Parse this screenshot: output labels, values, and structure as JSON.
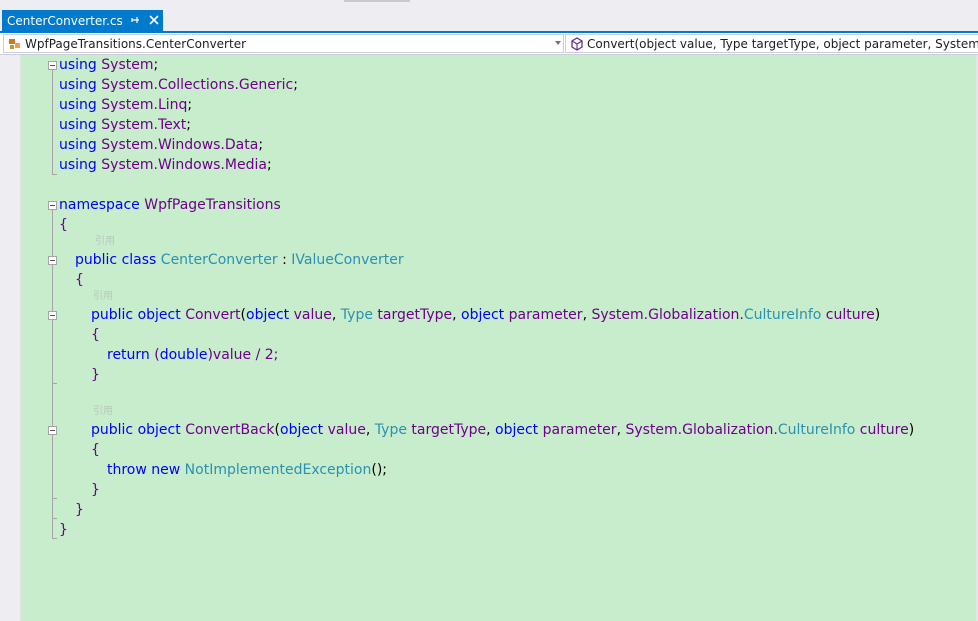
{
  "tab": {
    "title": "CenterConverter.cs",
    "pin_icon": "pin-icon",
    "close_icon": "close-icon"
  },
  "navbar": {
    "type_selector": "WpfPageTransitions.CenterConverter",
    "member_selector": "Convert(object value, Type targetType, object parameter, System.Gl"
  },
  "code": {
    "using1_kw": "using",
    "using1_ns": "System",
    "using2_kw": "using",
    "using2_ns": "System.Collections.Generic",
    "using3_kw": "using",
    "using3_ns": "System.Linq",
    "using4_kw": "using",
    "using4_ns": "System.Text",
    "using5_kw": "using",
    "using5_ns": "System.Windows.Data",
    "using6_kw": "using",
    "using6_ns": "System.Windows.Media",
    "namespace_kw": "namespace",
    "namespace_name": "WpfPageTransitions",
    "open_brace": "{",
    "close_brace": "}",
    "ref_label": "引用",
    "class_public": "public",
    "class_kw": "class",
    "class_name": "CenterConverter",
    "class_colon": ":",
    "class_interface": "IValueConverter",
    "convert_public": "public",
    "convert_object": "object",
    "convert_name": "Convert",
    "param_object": "object",
    "param_value": "value",
    "param_type": "Type",
    "param_target": "targetType",
    "param_object2": "object",
    "param_parameter": "parameter",
    "param_globalization": "System.Globalization.",
    "param_cultureinfo": "CultureInfo",
    "param_culture": "culture",
    "return_kw": "return",
    "double_kw": "double",
    "return_rest": "value / 2;",
    "convertback_name": "ConvertBack",
    "throw_kw": "throw",
    "new_kw": "new",
    "exception_name": "NotImplementedException",
    "exception_tail": "();"
  }
}
